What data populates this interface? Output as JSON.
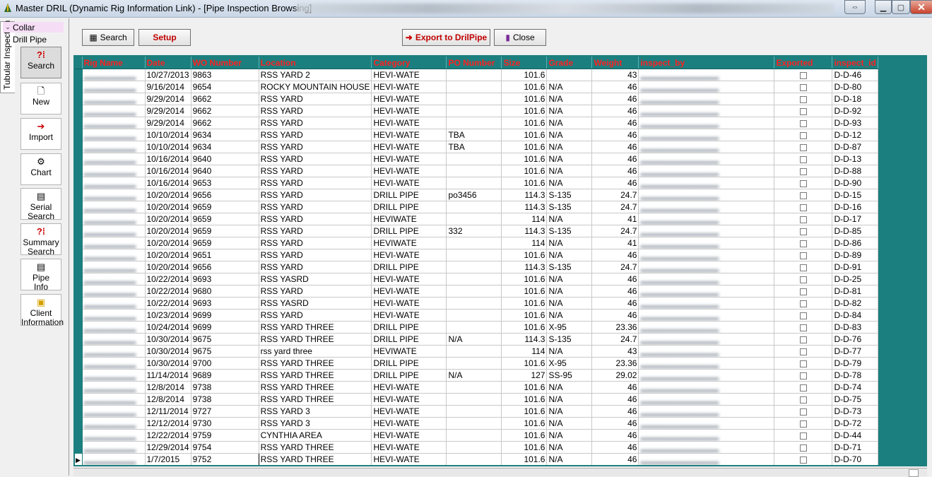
{
  "window": {
    "title": "Master DRIL (Dynamic Rig Information Link) - [Pipe Inspection Browsing]"
  },
  "sidebar": {
    "vertical_tab": "Tubular Inspection",
    "groups": [
      "Collar",
      "Drill Pipe"
    ],
    "buttons": [
      {
        "label1": "Search",
        "label2": "",
        "icon": "search-icon",
        "glyph": "?⁞"
      },
      {
        "label1": "New",
        "label2": "",
        "icon": "new-document-icon",
        "glyph": "🗋"
      },
      {
        "label1": "Import",
        "label2": "",
        "icon": "import-icon",
        "glyph": "➔"
      },
      {
        "label1": "Chart",
        "label2": "",
        "icon": "chart-icon",
        "glyph": "⚙"
      },
      {
        "label1": "Serial",
        "label2": "Search",
        "icon": "serial-search-icon",
        "glyph": "▤"
      },
      {
        "label1": "Summary",
        "label2": "Search",
        "icon": "summary-search-icon",
        "glyph": "?⁞"
      },
      {
        "label1": "Pipe",
        "label2": "Info",
        "icon": "pipe-info-icon",
        "glyph": "▤"
      },
      {
        "label1": "Client",
        "label2": "Information",
        "icon": "client-information-icon",
        "glyph": "▣"
      }
    ]
  },
  "toolbar": {
    "search_label": "Search",
    "setup_label": "Setup",
    "export_label": "Export to DrilPipe",
    "close_label": "Close"
  },
  "table": {
    "headers": [
      "Rig Name",
      "Date",
      "WO Number",
      "Location",
      "Category",
      "PO Number",
      "Size",
      "Grade",
      "Weight",
      "inspect_by",
      "Exported",
      "inspect_id"
    ],
    "rows": [
      [
        "",
        "10/27/2013",
        "9863",
        "RSS YARD 2",
        "HEVI-WATE",
        "",
        "101.6",
        "",
        "43",
        "",
        "",
        "D-D-46"
      ],
      [
        "",
        "9/16/2014",
        "9654",
        "ROCKY MOUNTAIN HOUSE",
        "HEVI-WATE",
        "",
        "101.6",
        "N/A",
        "46",
        "",
        "",
        "D-D-80"
      ],
      [
        "",
        "9/29/2014",
        "9662",
        "RSS YARD",
        "HEVI-WATE",
        "",
        "101.6",
        "N/A",
        "46",
        "",
        "",
        "D-D-18"
      ],
      [
        "",
        "9/29/2014",
        "9662",
        "RSS YARD",
        "HEVI-WATE",
        "",
        "101.6",
        "N/A",
        "46",
        "",
        "",
        "D-D-92"
      ],
      [
        "",
        "9/29/2014",
        "9662",
        "RSS YARD",
        "HEVI-WATE",
        "",
        "101.6",
        "N/A",
        "46",
        "",
        "",
        "D-D-93"
      ],
      [
        "",
        "10/10/2014",
        "9634",
        "RSS YARD",
        "HEVI-WATE",
        "TBA",
        "101.6",
        "N/A",
        "46",
        "",
        "",
        "D-D-12"
      ],
      [
        "",
        "10/10/2014",
        "9634",
        "RSS YARD",
        "HEVI-WATE",
        "TBA",
        "101.6",
        "N/A",
        "46",
        "",
        "",
        "D-D-87"
      ],
      [
        "",
        "10/16/2014",
        "9640",
        "RSS YARD",
        "HEVI-WATE",
        "",
        "101.6",
        "N/A",
        "46",
        "",
        "",
        "D-D-13"
      ],
      [
        "",
        "10/16/2014",
        "9640",
        "RSS YARD",
        "HEVI-WATE",
        "",
        "101.6",
        "N/A",
        "46",
        "",
        "",
        "D-D-88"
      ],
      [
        "",
        "10/16/2014",
        "9653",
        "RSS YARD",
        "HEVI-WATE",
        "",
        "101.6",
        "N/A",
        "46",
        "",
        "",
        "D-D-90"
      ],
      [
        "",
        "10/20/2014",
        "9656",
        "RSS YARD",
        "DRILL PIPE",
        "po3456",
        "114.3",
        "S-135",
        "24.7",
        "",
        "",
        "D-D-15"
      ],
      [
        "",
        "10/20/2014",
        "9659",
        "RSS YARD",
        "DRILL PIPE",
        "",
        "114.3",
        "S-135",
        "24.7",
        "",
        "",
        "D-D-16"
      ],
      [
        "",
        "10/20/2014",
        "9659",
        "RSS YARD",
        "HEVIWATE",
        "",
        "114",
        "N/A",
        "41",
        "",
        "",
        "D-D-17"
      ],
      [
        "",
        "10/20/2014",
        "9659",
        "RSS YARD",
        "DRILL PIPE",
        "332",
        "114.3",
        "S-135",
        "24.7",
        "",
        "",
        "D-D-85"
      ],
      [
        "",
        "10/20/2014",
        "9659",
        "RSS YARD",
        "HEVIWATE",
        "",
        "114",
        "N/A",
        "41",
        "",
        "",
        "D-D-86"
      ],
      [
        "",
        "10/20/2014",
        "9651",
        "RSS YARD",
        "HEVI-WATE",
        "",
        "101.6",
        "N/A",
        "46",
        "",
        "",
        "D-D-89"
      ],
      [
        "",
        "10/20/2014",
        "9656",
        "RSS YARD",
        "DRILL PIPE",
        "",
        "114.3",
        "S-135",
        "24.7",
        "",
        "",
        "D-D-91"
      ],
      [
        "",
        "10/22/2014",
        "9693",
        "RSS YASRD",
        "HEVI-WATE",
        "",
        "101.6",
        "N/A",
        "46",
        "",
        "",
        "D-D-25"
      ],
      [
        "",
        "10/22/2014",
        "9680",
        "RSS YARD",
        "HEVI-WATE",
        "",
        "101.6",
        "N/A",
        "46",
        "",
        "",
        "D-D-81"
      ],
      [
        "",
        "10/22/2014",
        "9693",
        "RSS YASRD",
        "HEVI-WATE",
        "",
        "101.6",
        "N/A",
        "46",
        "",
        "",
        "D-D-82"
      ],
      [
        "",
        "10/23/2014",
        "9699",
        "RSS YARD",
        "HEVI-WATE",
        "",
        "101.6",
        "N/A",
        "46",
        "",
        "",
        "D-D-84"
      ],
      [
        "",
        "10/24/2014",
        "9699",
        "RSS YARD THREE",
        "DRILL PIPE",
        "",
        "101.6",
        "X-95",
        "23.36",
        "",
        "",
        "D-D-83"
      ],
      [
        "",
        "10/30/2014",
        "9675",
        "RSS YARD THREE",
        "DRILL PIPE",
        "N/A",
        "114.3",
        "S-135",
        "24.7",
        "",
        "",
        "D-D-76"
      ],
      [
        "",
        "10/30/2014",
        "9675",
        "rss yard three",
        "HEVIWATE",
        "",
        "114",
        "N/A",
        "43",
        "",
        "",
        "D-D-77"
      ],
      [
        "",
        "10/30/2014",
        "9700",
        "RSS YARD THREE",
        "DRILL PIPE",
        "",
        "101.6",
        "X-95",
        "23.36",
        "",
        "",
        "D-D-79"
      ],
      [
        "",
        "11/14/2014",
        "9689",
        "RSS YARD THREE",
        "DRILL PIPE",
        "N/A",
        "127",
        "SS-95",
        "29.02",
        "",
        "",
        "D-D-78"
      ],
      [
        "",
        "12/8/2014",
        "9738",
        "RSS YARD THREE",
        "HEVI-WATE",
        "",
        "101.6",
        "N/A",
        "46",
        "",
        "",
        "D-D-74"
      ],
      [
        "",
        "12/8/2014",
        "9738",
        "RSS YARD THREE",
        "HEVI-WATE",
        "",
        "101.6",
        "N/A",
        "46",
        "",
        "",
        "D-D-75"
      ],
      [
        "",
        "12/11/2014",
        "9727",
        "RSS YARD 3",
        "HEVI-WATE",
        "",
        "101.6",
        "N/A",
        "46",
        "",
        "",
        "D-D-73"
      ],
      [
        "",
        "12/12/2014",
        "9730",
        "RSS YARD 3",
        "HEVI-WATE",
        "",
        "101.6",
        "N/A",
        "46",
        "",
        "",
        "D-D-72"
      ],
      [
        "",
        "12/22/2014",
        "9759",
        "CYNTHIA AREA",
        "HEVI-WATE",
        "",
        "101.6",
        "N/A",
        "46",
        "",
        "",
        "D-D-44"
      ],
      [
        "",
        "12/29/2014",
        "9754",
        "RSS YARD THREE",
        "HEVI-WATE",
        "",
        "101.6",
        "N/A",
        "46",
        "",
        "",
        "D-D-71"
      ],
      [
        "",
        "1/7/2015",
        "9752",
        "RSS YARD THREE",
        "HEVI-WATE",
        "",
        "101.6",
        "N/A",
        "46",
        "",
        "",
        "D-D-70"
      ]
    ]
  },
  "colors": {
    "grid_teal": "#1c7f7f",
    "header_text": "#ff2020",
    "toolbar_red": "#c00000"
  }
}
